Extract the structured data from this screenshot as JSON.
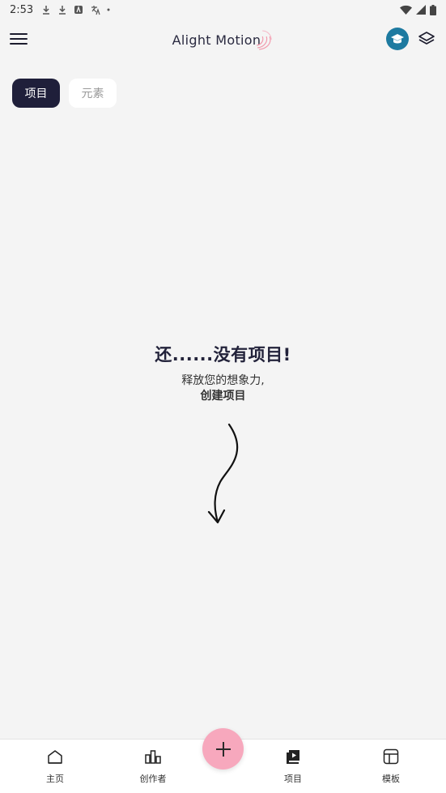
{
  "status_bar": {
    "time": "2:53",
    "left_icons": [
      "download-icon",
      "download-icon",
      "a-icon",
      "translate-icon",
      "dot-icon"
    ],
    "right_icons": [
      "wifi-icon",
      "signal-icon",
      "battery-icon"
    ]
  },
  "app_bar": {
    "brand": "Alight Motion",
    "accent_color": "#1d7aa0",
    "swirl_color": "#f29aad"
  },
  "tabs": [
    {
      "label": "项目",
      "active": true
    },
    {
      "label": "元素",
      "active": false
    }
  ],
  "empty_state": {
    "title": "还......没有项目!",
    "line1": "释放您的想象力,",
    "line2": "创建项目"
  },
  "bottom_nav": {
    "items": [
      {
        "label": "主页",
        "icon": "home-icon"
      },
      {
        "label": "创作者",
        "icon": "creators-icon"
      },
      {
        "label": "项目",
        "icon": "projects-icon"
      },
      {
        "label": "模板",
        "icon": "templates-icon"
      }
    ],
    "fab_symbol": "+",
    "fab_color": "#f7a8bd"
  }
}
